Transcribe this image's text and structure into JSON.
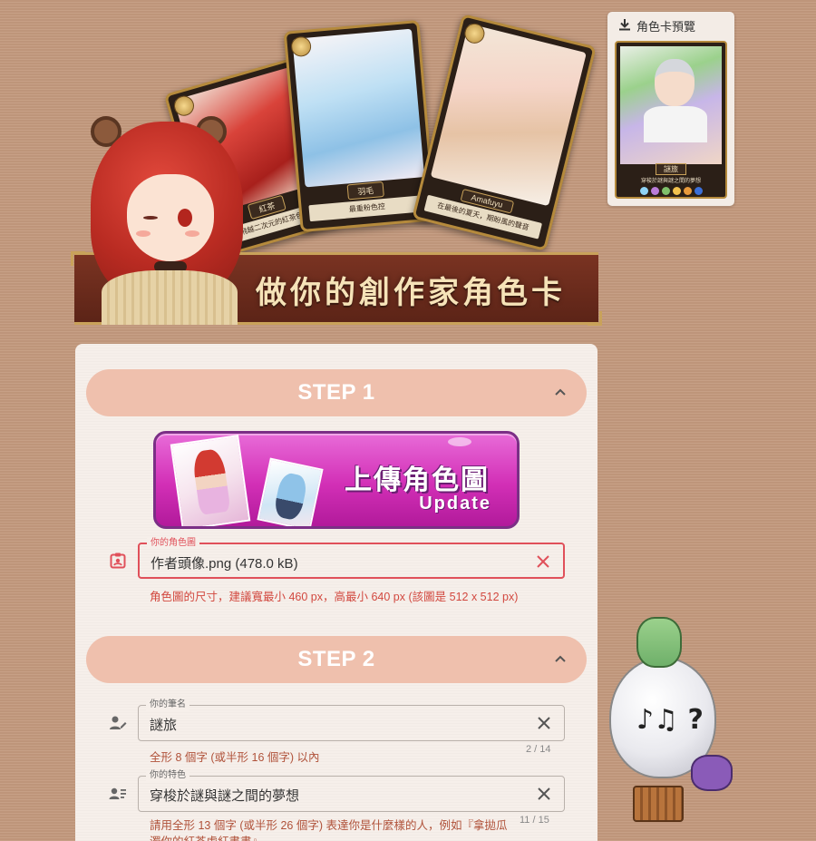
{
  "banner": {
    "title": "做你的創作家角色卡",
    "cards": [
      {
        "name": "紅茶",
        "desc": "飛越二次元的紅茶色"
      },
      {
        "name": "羽毛",
        "desc": "最重粉色控"
      },
      {
        "name": "Amafuyu",
        "desc": "在最後的夏天，期盼風的聲音"
      }
    ]
  },
  "preview": {
    "title": "角色卡預覽",
    "card_name": "謎旅",
    "card_desc": "穿梭於謎與謎之間的夢想",
    "gem_colors": [
      "#8fd3f5",
      "#b97cd8",
      "#7fbf6a",
      "#f2c14e",
      "#e89a3c",
      "#3b6fd8"
    ]
  },
  "step1": {
    "label": "STEP 1",
    "upload": {
      "title": "上傳角色圖",
      "subtitle": "Update"
    },
    "file_field": {
      "label": "你的角色圖",
      "value": "作者頭像.png (478.0 kB)"
    },
    "hint": "角色圖的尺寸，建議寬最小 460 px，高最小 640 px (該圖是 512 x 512 px)"
  },
  "step2": {
    "label": "STEP 2",
    "pen_name": {
      "label": "你的筆名",
      "value": "謎旅",
      "hint": "全形 8 個字 (或半形 16 個字) 以內",
      "counter": "2 / 14"
    },
    "feature": {
      "label": "你的特色",
      "value": "穿梭於謎與謎之間的夢想",
      "hint": "請用全形 13 個字 (或半形 26 個字) 表達你是什麼樣的人，例如『拿拋瓜濁你的紅茶處紅書書』",
      "counter": "11 / 15"
    }
  },
  "mascot": {
    "glyph": "♪♫ ?"
  },
  "colors": {
    "background": "#c49a7e",
    "panel": "#f6efea",
    "step_bar": "#efc0ad",
    "error": "#e0505a",
    "upload_magenta": "#d22fb6"
  }
}
